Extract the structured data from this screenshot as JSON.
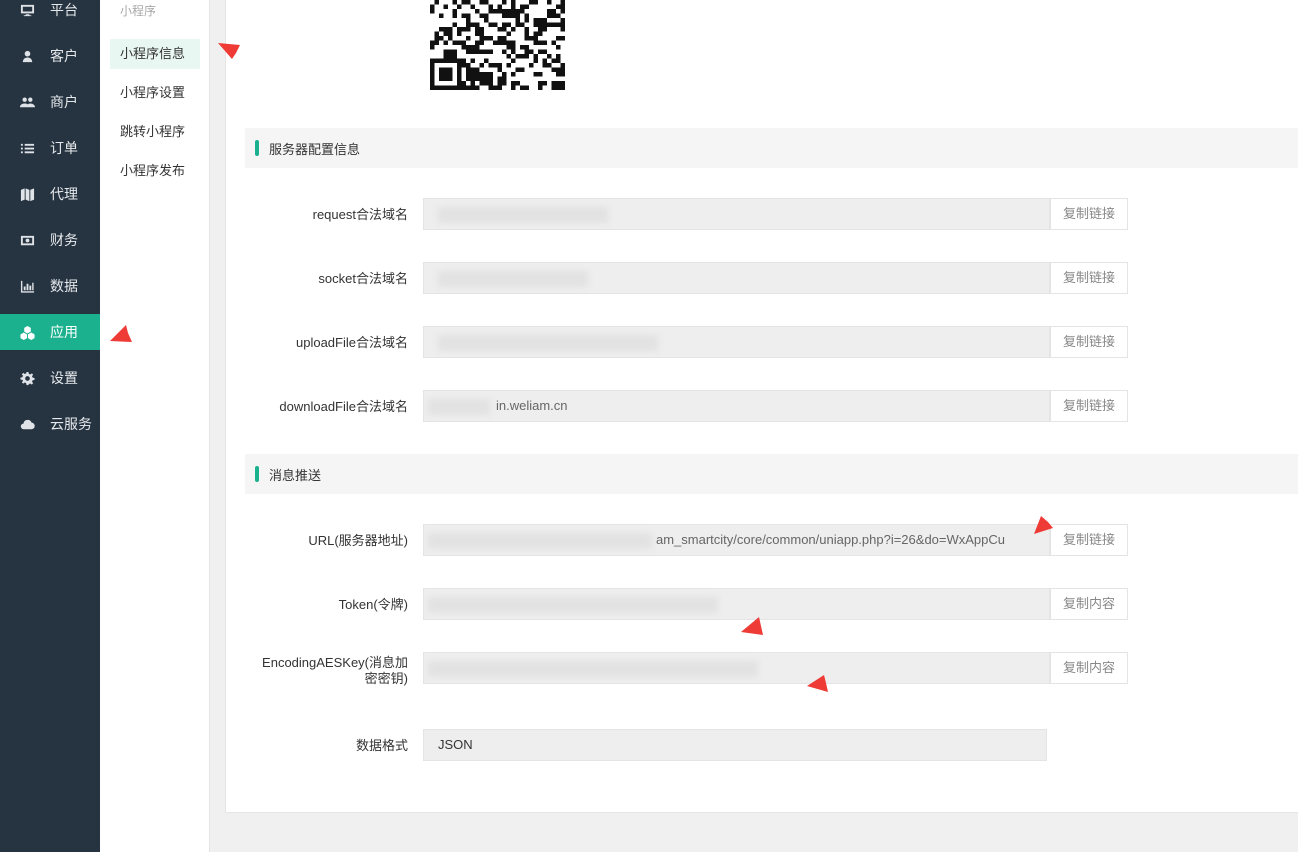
{
  "nav": {
    "items": [
      {
        "label": "平台",
        "icon": "monitor-icon"
      },
      {
        "label": "客户",
        "icon": "user-icon"
      },
      {
        "label": "商户",
        "icon": "users-icon"
      },
      {
        "label": "订单",
        "icon": "list-icon"
      },
      {
        "label": "代理",
        "icon": "map-icon"
      },
      {
        "label": "财务",
        "icon": "money-icon"
      },
      {
        "label": "数据",
        "icon": "bar-chart-icon"
      },
      {
        "label": "应用",
        "icon": "cubes-icon"
      },
      {
        "label": "设置",
        "icon": "gear-icon"
      },
      {
        "label": "云服务",
        "icon": "cloud-icon"
      }
    ],
    "active_index": 7,
    "accent_color": "#1bb18e",
    "background_color": "#263340"
  },
  "submenu": {
    "title": "小程序",
    "items": [
      "小程序信息",
      "小程序设置",
      "跳转小程序",
      "小程序发布"
    ],
    "active_index": 0
  },
  "sections": {
    "server": {
      "title": "服务器配置信息",
      "rows": [
        {
          "label": "request合法域名",
          "value": "",
          "button": "复制链接"
        },
        {
          "label": "socket合法域名",
          "value": "",
          "button": "复制链接"
        },
        {
          "label": "uploadFile合法域名",
          "value": "",
          "button": "复制链接"
        },
        {
          "label": "downloadFile合法域名",
          "value": "in.weliam.cn",
          "button": "复制链接"
        }
      ]
    },
    "message": {
      "title": "消息推送",
      "rows": [
        {
          "label": "URL(服务器地址)",
          "value": "am_smartcity/core/common/uniapp.php?i=26&do=WxAppCu",
          "button": "复制链接"
        },
        {
          "label": "Token(令牌)",
          "value": "",
          "button": "复制内容"
        },
        {
          "label": "EncodingAESKey(消息加密密钥)",
          "label_line1": "EncodingAESKey(消息加",
          "label_line2": "密密钥)",
          "value": "",
          "button": "复制内容"
        },
        {
          "label": "数据格式",
          "value": "JSON"
        }
      ]
    }
  }
}
